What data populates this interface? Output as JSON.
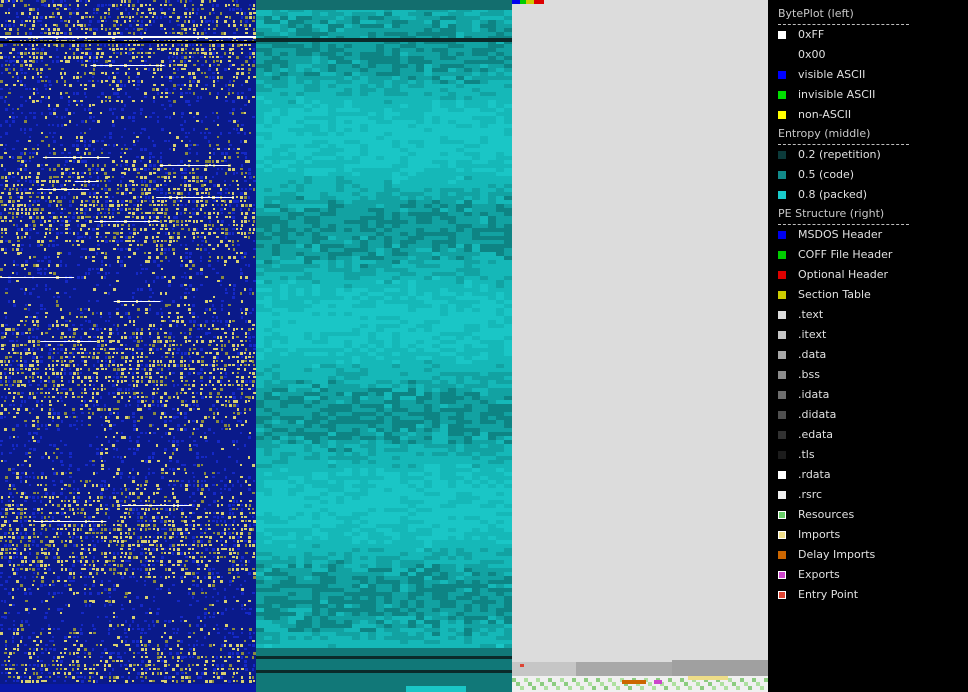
{
  "legend": {
    "sections": [
      {
        "title": "BytePlot (left)",
        "items": [
          {
            "label": "0xFF",
            "color": "#ffffff"
          },
          {
            "label": "0x00",
            "color": "#000000"
          },
          {
            "label": "visible ASCII",
            "color": "#0000ff"
          },
          {
            "label": "invisible ASCII",
            "color": "#00dd00"
          },
          {
            "label": "non-ASCII",
            "color": "#ffff00"
          }
        ]
      },
      {
        "title": "Entropy (middle)",
        "items": [
          {
            "label": "0.2 (repetition)",
            "color": "#0c3a3a"
          },
          {
            "label": "0.5 (code)",
            "color": "#128a8a"
          },
          {
            "label": "0.8 (packed)",
            "color": "#19caca"
          }
        ]
      },
      {
        "title": "PE Structure (right)",
        "items": [
          {
            "label": "MSDOS Header",
            "color": "#0000ee"
          },
          {
            "label": "COFF File Header",
            "color": "#00cc00"
          },
          {
            "label": "Optional Header",
            "color": "#dd0000"
          },
          {
            "label": "Section Table",
            "color": "#cccc00"
          },
          {
            "label": ".text",
            "color": "#dcdcdc"
          },
          {
            "label": ".itext",
            "color": "#c6c6c6"
          },
          {
            "label": ".data",
            "color": "#a8a8a8"
          },
          {
            "label": ".bss",
            "color": "#8c8c8c"
          },
          {
            "label": ".idata",
            "color": "#6e6e6e"
          },
          {
            "label": ".didata",
            "color": "#505050"
          },
          {
            "label": ".edata",
            "color": "#323232"
          },
          {
            "label": ".tls",
            "color": "#1c1c1c"
          },
          {
            "label": ".rdata",
            "color": "#ffffff"
          },
          {
            "label": ".rsrc",
            "color": "#f0f0f0"
          },
          {
            "label": "Resources",
            "color": "#66cc66",
            "bordered": true
          },
          {
            "label": "Imports",
            "color": "#eedd88",
            "bordered": true
          },
          {
            "label": "Delay Imports",
            "color": "#cc6600"
          },
          {
            "label": "Exports",
            "color": "#cc44cc",
            "bordered": true
          },
          {
            "label": "Entry Point",
            "color": "#dd4433",
            "bordered": true
          }
        ]
      }
    ]
  },
  "colors": {
    "byteplot_base": "#0a1a8a",
    "entropy_base": "#13b8b8",
    "pe_text": "#dcdcdc",
    "background": "#000000"
  }
}
